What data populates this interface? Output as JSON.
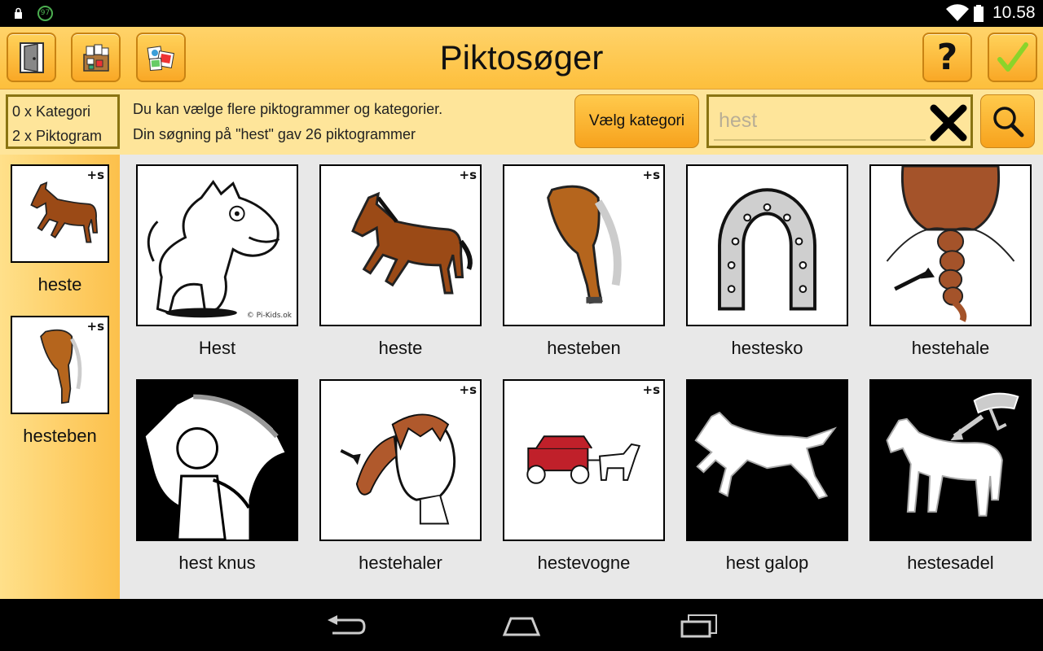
{
  "status": {
    "time": "10.58",
    "notification_badge": "97"
  },
  "toolbar": {
    "title": "Piktosøger",
    "help_label": "?",
    "icons": [
      "door-icon",
      "category-folder-icon",
      "photo-collection-icon",
      "help-icon",
      "checkmark-icon"
    ]
  },
  "info": {
    "category_count": "0 x Kategori",
    "pictogram_count": "2 x Piktogram",
    "line1": "Du kan vælge flere piktogrammer og kategorier.",
    "line2": "Din søgning på \"hest\" gav 26 piktogrammer",
    "choose_category": "Vælg kategori",
    "search_placeholder": "hest"
  },
  "selected": [
    {
      "label": "heste",
      "plus_s": "+s"
    },
    {
      "label": "hesteben",
      "plus_s": "+s"
    }
  ],
  "results": [
    {
      "label": "Hest",
      "plus_s": "",
      "credit": "© Pi-Kids.ok"
    },
    {
      "label": "heste",
      "plus_s": "+s"
    },
    {
      "label": "hesteben",
      "plus_s": "+s"
    },
    {
      "label": "hestesko",
      "plus_s": ""
    },
    {
      "label": "hestehale",
      "plus_s": ""
    },
    {
      "label": "hest knus",
      "plus_s": ""
    },
    {
      "label": "hestehaler",
      "plus_s": "+s"
    },
    {
      "label": "hestevogne",
      "plus_s": "+s"
    },
    {
      "label": "hest galop",
      "plus_s": ""
    },
    {
      "label": "hestesadel",
      "plus_s": ""
    }
  ],
  "colors": {
    "accent": "#f9a826",
    "panel": "#fee59a",
    "check": "#8bd42a"
  }
}
